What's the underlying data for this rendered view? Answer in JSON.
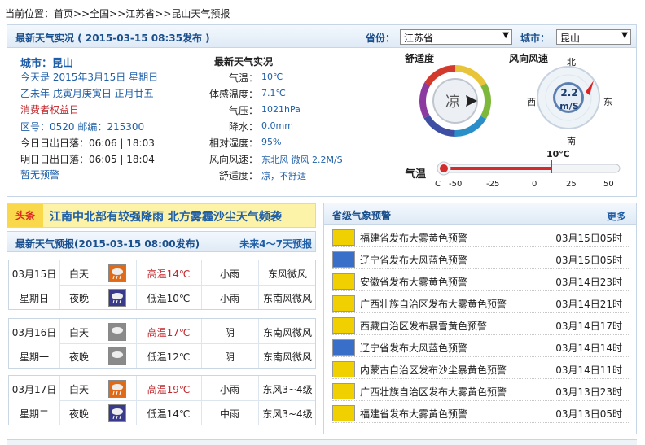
{
  "breadcrumb": {
    "prefix": "当前位置：",
    "home": "首页",
    "sep1": ">>",
    "country": "全国",
    "sep2": ">>",
    "province": "江苏省",
    "sep3": ">>",
    "page": "昆山天气预报"
  },
  "live": {
    "header_title": "最新天气实况 ( 2015-03-15  08:35发布 )",
    "province_label": "省份：",
    "province_value": "江苏省",
    "city_label": "城市：",
    "city_value": "昆山",
    "city_name": "城市：昆山",
    "date_line": "今天是  2015年3月15日 星期日",
    "lunar_line": "乙未年 戊寅月庚寅日 正月廿五",
    "festival": "消费者权益日",
    "code_line": "区号：0520  邮编：215300",
    "today_sun": "今日日出日落：06:06 | 18:03",
    "tomorrow_sun": "明日日出日落：06:05 | 18:04",
    "alert": "暂无预警",
    "obs_title": "最新天气实况",
    "obs": [
      {
        "label": "气温：",
        "value": "10℃"
      },
      {
        "label": "体感温度：",
        "value": "7.1℃"
      },
      {
        "label": "气压：",
        "value": "1021hPa"
      },
      {
        "label": "降水：",
        "value": "0.0mm"
      },
      {
        "label": "相对湿度：",
        "value": "95%"
      },
      {
        "label": "风向风速：",
        "value": "东北风 微风 2.2M/S"
      },
      {
        "label": "舒适度：",
        "value": "凉，不舒适"
      }
    ],
    "comfort_title": "舒适度",
    "comfort_value": "凉",
    "wind_title": "风向风速",
    "wind_speed": "2.2",
    "wind_unit": "m/S",
    "compass": {
      "n": "北",
      "s": "南",
      "e": "东",
      "w": "西"
    },
    "thermo_label": "气温",
    "thermo_value": "10℃",
    "thermo_value_c": 10,
    "thermo_unit": "C",
    "thermo_ticks": [
      "-50",
      "-25",
      "0",
      "25",
      "50"
    ]
  },
  "headline": {
    "tag": "头条",
    "text": "江南中北部有较强降雨  北方雾霾沙尘天气频袭"
  },
  "forecast": {
    "title": "最新天气预报(2015-03-15  08:00发布)",
    "more": "未来4～7天预报",
    "days": [
      {
        "date": "03月15日",
        "weekday": "星期日",
        "day": {
          "period": "白天",
          "temp": "高温14℃",
          "weather": "小雨",
          "wind": "东风微风",
          "icon": "light-rain-day-icon"
        },
        "night": {
          "period": "夜晚",
          "temp": "低温10℃",
          "weather": "小雨",
          "wind": "东南风微风",
          "icon": "light-rain-night-icon"
        }
      },
      {
        "date": "03月16日",
        "weekday": "星期一",
        "day": {
          "period": "白天",
          "temp": "高温17℃",
          "weather": "阴",
          "wind": "东南风微风",
          "icon": "overcast-icon"
        },
        "night": {
          "period": "夜晚",
          "temp": "低温12℃",
          "weather": "阴",
          "wind": "东南风微风",
          "icon": "overcast-icon"
        }
      },
      {
        "date": "03月17日",
        "weekday": "星期二",
        "day": {
          "period": "白天",
          "temp": "高温19℃",
          "weather": "小雨",
          "wind": "东风3~4级",
          "icon": "light-rain-day-icon"
        },
        "night": {
          "period": "夜晚",
          "temp": "低温14℃",
          "weather": "中雨",
          "wind": "东风3~4级",
          "icon": "moderate-rain-night-icon"
        }
      }
    ]
  },
  "warnings": {
    "title": "省级气象预警",
    "more": "更多",
    "items": [
      {
        "text": "福建省发布大雾黄色预警",
        "time": "03月15日05时",
        "color": "#f0d000",
        "icon": "fog-yellow-icon"
      },
      {
        "text": "辽宁省发布大风蓝色预警",
        "time": "03月15日05时",
        "color": "#3a6fc9",
        "icon": "wind-blue-icon"
      },
      {
        "text": "安徽省发布大雾黄色预警",
        "time": "03月14日23时",
        "color": "#f0d000",
        "icon": "fog-yellow-icon"
      },
      {
        "text": "广西壮族自治区发布大雾黄色预警",
        "time": "03月14日21时",
        "color": "#f0d000",
        "icon": "fog-yellow-icon"
      },
      {
        "text": "西藏自治区发布暴雪黄色预警",
        "time": "03月14日17时",
        "color": "#f0d000",
        "icon": "snow-yellow-icon"
      },
      {
        "text": "辽宁省发布大风蓝色预警",
        "time": "03月14日14时",
        "color": "#3a6fc9",
        "icon": "wind-blue-icon"
      },
      {
        "text": "内蒙古自治区发布沙尘暴黄色预警",
        "time": "03月14日11时",
        "color": "#f0d000",
        "icon": "sandstorm-yellow-icon"
      },
      {
        "text": "广西壮族自治区发布大雾黄色预警",
        "time": "03月13日23时",
        "color": "#f0d000",
        "icon": "fog-yellow-icon"
      },
      {
        "text": "福建省发布大雾黄色预警",
        "time": "03月13日05时",
        "color": "#f0d000",
        "icon": "fog-yellow-icon"
      }
    ]
  }
}
